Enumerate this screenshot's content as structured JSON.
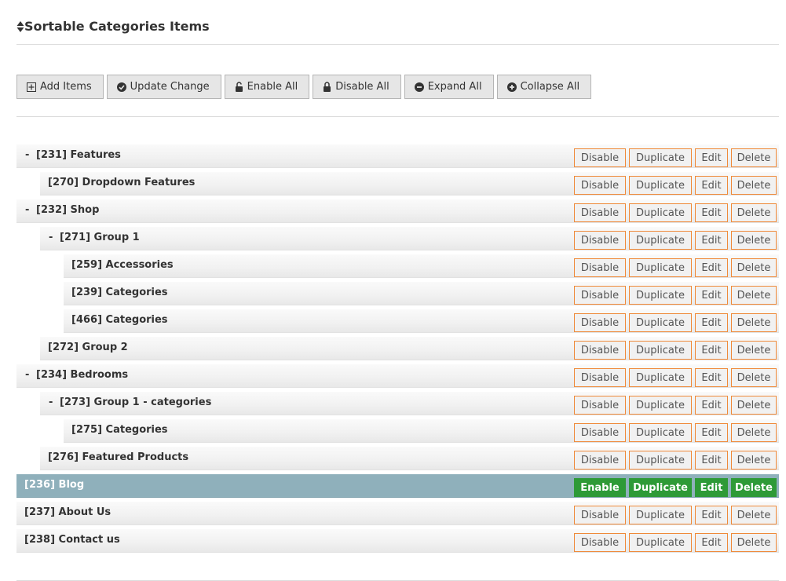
{
  "header": {
    "title": "Sortable Categories Items",
    "icon": "sort-icon"
  },
  "toolbar": {
    "add_items": "Add Items",
    "update_change": "Update Change",
    "enable_all": "Enable All",
    "disable_all": "Disable All",
    "expand_all": "Expand All",
    "collapse_all": "Collapse All"
  },
  "row_actions": {
    "disable": "Disable",
    "enable": "Enable",
    "duplicate": "Duplicate",
    "edit": "Edit",
    "delete": "Delete"
  },
  "items": [
    {
      "label": "[231] Features",
      "level": 0,
      "toggle": "-",
      "status": "enabled"
    },
    {
      "label": "[270] Dropdown Features",
      "level": 1,
      "toggle": "",
      "status": "enabled"
    },
    {
      "label": "[232] Shop",
      "level": 0,
      "toggle": "-",
      "status": "enabled"
    },
    {
      "label": "[271] Group 1",
      "level": 1,
      "toggle": "-",
      "status": "enabled"
    },
    {
      "label": "[259] Accessories",
      "level": 2,
      "toggle": "",
      "status": "enabled"
    },
    {
      "label": "[239] Categories",
      "level": 2,
      "toggle": "",
      "status": "enabled"
    },
    {
      "label": "[466] Categories",
      "level": 2,
      "toggle": "",
      "status": "enabled"
    },
    {
      "label": "[272] Group 2",
      "level": 1,
      "toggle": "",
      "status": "enabled"
    },
    {
      "label": "[234] Bedrooms",
      "level": 0,
      "toggle": "-",
      "status": "enabled"
    },
    {
      "label": "[273] Group 1 - categories",
      "level": 1,
      "toggle": "-",
      "status": "enabled"
    },
    {
      "label": "[275] Categories",
      "level": 2,
      "toggle": "",
      "status": "enabled"
    },
    {
      "label": "[276] Featured Products",
      "level": 1,
      "toggle": "",
      "status": "enabled"
    },
    {
      "label": "[236] Blog",
      "level": 0,
      "toggle": "",
      "status": "disabled"
    },
    {
      "label": "[237] About Us",
      "level": 0,
      "toggle": "",
      "status": "enabled"
    },
    {
      "label": "[238] Contact us",
      "level": 0,
      "toggle": "",
      "status": "enabled"
    }
  ],
  "colors": {
    "action_border": "#ef8a3a",
    "disabled_row_bg": "#8fb0bb",
    "disabled_row_button": "#2e9a37"
  }
}
